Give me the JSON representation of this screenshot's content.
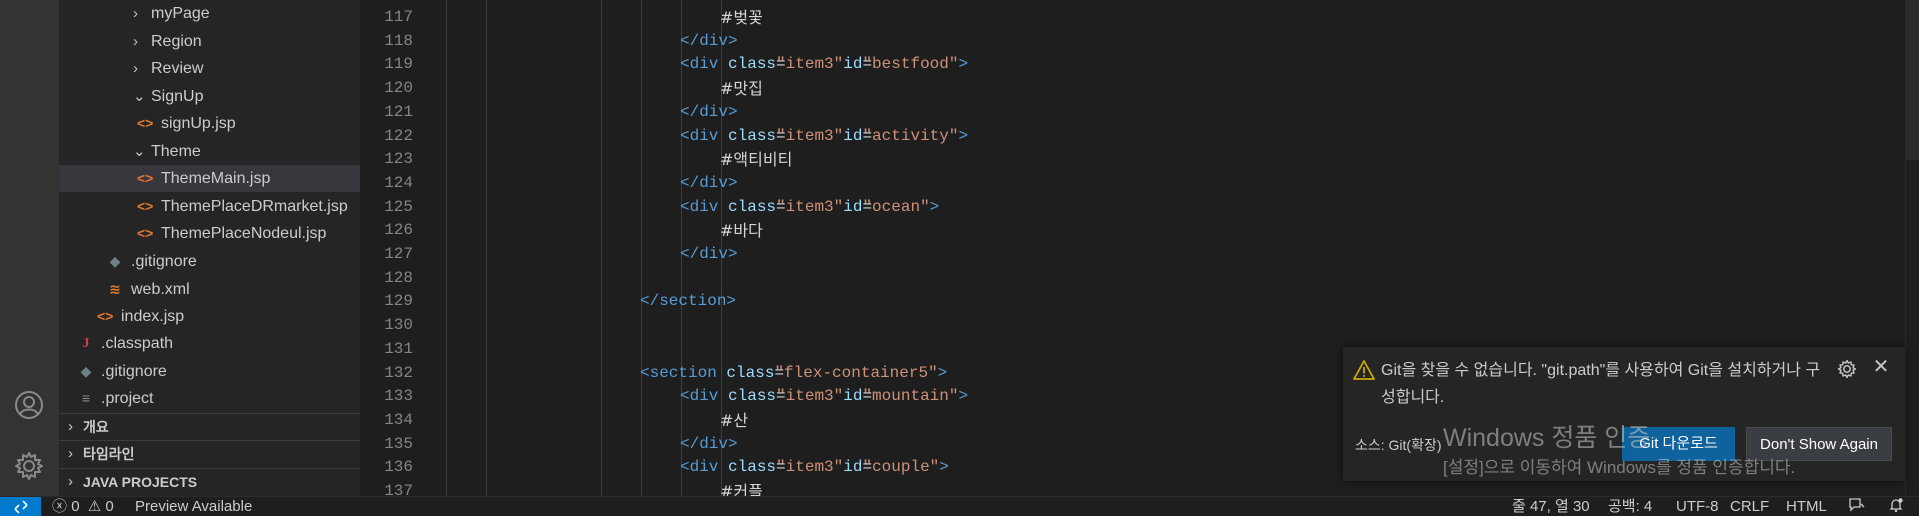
{
  "explorer": {
    "rows": [
      {
        "label": "myPage",
        "type": "folder",
        "expanded": false
      },
      {
        "label": "Region",
        "type": "folder",
        "expanded": false
      },
      {
        "label": "Review",
        "type": "folder",
        "expanded": false
      },
      {
        "label": "SignUp",
        "type": "folder",
        "expanded": true
      },
      {
        "label": "signUp.jsp",
        "type": "file",
        "icon": "code-file-icon"
      },
      {
        "label": "Theme",
        "type": "folder",
        "expanded": true
      },
      {
        "label": "ThemeMain.jsp",
        "type": "file",
        "icon": "code-file-icon",
        "selected": true
      },
      {
        "label": "ThemePlaceDRmarket.jsp",
        "type": "file",
        "icon": "code-file-icon"
      },
      {
        "label": "ThemePlaceNodeul.jsp",
        "type": "file",
        "icon": "code-file-icon"
      },
      {
        "label": ".gitignore",
        "type": "file",
        "icon": "git-file-icon"
      },
      {
        "label": "web.xml",
        "type": "file",
        "icon": "rss-file-icon"
      },
      {
        "label": "index.jsp",
        "type": "file",
        "icon": "code-file-icon"
      },
      {
        "label": ".classpath",
        "type": "file",
        "icon": "java-file-icon"
      },
      {
        "label": ".gitignore",
        "type": "file",
        "icon": "git-file-icon"
      },
      {
        "label": ".project",
        "type": "file",
        "icon": "lines-file-icon"
      }
    ],
    "panels": [
      "개요",
      "타임라인",
      "JAVA PROJECTS"
    ]
  },
  "editor": {
    "lines": [
      {
        "n": "117",
        "tokens": [
          {
            "c": "txt",
            "t": "#벚꽃"
          }
        ]
      },
      {
        "n": "118",
        "tokens": [
          {
            "c": "tag",
            "t": "</div>"
          }
        ]
      },
      {
        "n": "119",
        "tokens": [
          {
            "c": "tag",
            "t": "<div "
          },
          {
            "c": "attr",
            "t": "class"
          },
          {
            "c": "code",
            "t": "="
          },
          {
            "c": "str",
            "t": "\"item3\""
          },
          {
            "c": "code",
            "t": " "
          },
          {
            "c": "attr",
            "t": "id"
          },
          {
            "c": "code",
            "t": "="
          },
          {
            "c": "str",
            "t": "\"bestfood\""
          },
          {
            "c": "tag",
            "t": ">"
          }
        ]
      },
      {
        "n": "120",
        "tokens": [
          {
            "c": "txt",
            "t": "#맛집"
          }
        ]
      },
      {
        "n": "121",
        "tokens": [
          {
            "c": "tag",
            "t": "</div>"
          }
        ]
      },
      {
        "n": "122",
        "tokens": [
          {
            "c": "tag",
            "t": "<div "
          },
          {
            "c": "attr",
            "t": "class"
          },
          {
            "c": "code",
            "t": "="
          },
          {
            "c": "str",
            "t": "\"item3\""
          },
          {
            "c": "code",
            "t": " "
          },
          {
            "c": "attr",
            "t": "id"
          },
          {
            "c": "code",
            "t": "="
          },
          {
            "c": "str",
            "t": "\"activity\""
          },
          {
            "c": "tag",
            "t": ">"
          }
        ]
      },
      {
        "n": "123",
        "tokens": [
          {
            "c": "txt",
            "t": "#액티비티"
          }
        ]
      },
      {
        "n": "124",
        "tokens": [
          {
            "c": "tag",
            "t": "</div>"
          }
        ]
      },
      {
        "n": "125",
        "tokens": [
          {
            "c": "tag",
            "t": "<div "
          },
          {
            "c": "attr",
            "t": "class"
          },
          {
            "c": "code",
            "t": "="
          },
          {
            "c": "str",
            "t": "\"item3\""
          },
          {
            "c": "code",
            "t": " "
          },
          {
            "c": "attr",
            "t": "id"
          },
          {
            "c": "code",
            "t": "="
          },
          {
            "c": "str",
            "t": "\"ocean\""
          },
          {
            "c": "tag",
            "t": ">"
          }
        ]
      },
      {
        "n": "126",
        "tokens": [
          {
            "c": "txt",
            "t": "#바다"
          }
        ]
      },
      {
        "n": "127",
        "tokens": [
          {
            "c": "tag",
            "t": "</div>"
          }
        ]
      },
      {
        "n": "128",
        "tokens": []
      },
      {
        "n": "129",
        "tokens": [
          {
            "c": "tag",
            "t": "</section>"
          }
        ]
      },
      {
        "n": "130",
        "tokens": []
      },
      {
        "n": "131",
        "tokens": []
      },
      {
        "n": "132",
        "tokens": [
          {
            "c": "tag",
            "t": "<section "
          },
          {
            "c": "attr",
            "t": "class"
          },
          {
            "c": "code",
            "t": "="
          },
          {
            "c": "str",
            "t": "\"flex-container5\""
          },
          {
            "c": "tag",
            "t": ">"
          }
        ]
      },
      {
        "n": "133",
        "tokens": [
          {
            "c": "tag",
            "t": "<div "
          },
          {
            "c": "attr",
            "t": "class"
          },
          {
            "c": "code",
            "t": "="
          },
          {
            "c": "str",
            "t": "\"item3\""
          },
          {
            "c": "code",
            "t": " "
          },
          {
            "c": "attr",
            "t": "id"
          },
          {
            "c": "code",
            "t": "="
          },
          {
            "c": "str",
            "t": "\"mountain\""
          },
          {
            "c": "tag",
            "t": ">"
          }
        ]
      },
      {
        "n": "134",
        "tokens": [
          {
            "c": "txt",
            "t": "#산"
          }
        ]
      },
      {
        "n": "135",
        "tokens": [
          {
            "c": "tag",
            "t": "</div>"
          }
        ]
      },
      {
        "n": "136",
        "tokens": [
          {
            "c": "tag",
            "t": "<div "
          },
          {
            "c": "attr",
            "t": "class"
          },
          {
            "c": "code",
            "t": "="
          },
          {
            "c": "str",
            "t": "\"item3\""
          },
          {
            "c": "code",
            "t": " "
          },
          {
            "c": "attr",
            "t": "id"
          },
          {
            "c": "code",
            "t": "="
          },
          {
            "c": "str",
            "t": "\"couple\""
          },
          {
            "c": "tag",
            "t": ">"
          }
        ]
      },
      {
        "n": "137",
        "tokens": [
          {
            "c": "txt",
            "t": "#커플"
          }
        ]
      }
    ]
  },
  "notification": {
    "message": "Git을 찾을 수 없습니다. \"git.path\"를 사용하여 Git을 설치하거나 구성합니다.",
    "source": "소스: Git(확장)",
    "primary_button": "Git 다운로드",
    "secondary_button": "Don't Show Again"
  },
  "watermark": {
    "title": "Windows 정품 인증",
    "subtitle": "[설정]으로 이동하여 Windows를 정품 인증합니다."
  },
  "statusbar": {
    "problems_errors": "0",
    "problems_warnings": "0",
    "preview": "Preview Available",
    "cursor": "줄 47, 열 30",
    "indent": "공백: 4",
    "encoding": "UTF-8",
    "eol": "CRLF",
    "language": "HTML"
  },
  "colors": {
    "accent": "#007acc",
    "tag": "#569cd6",
    "attribute": "#9cdcfe",
    "string": "#ce9178",
    "button_primary": "#0e639c"
  }
}
